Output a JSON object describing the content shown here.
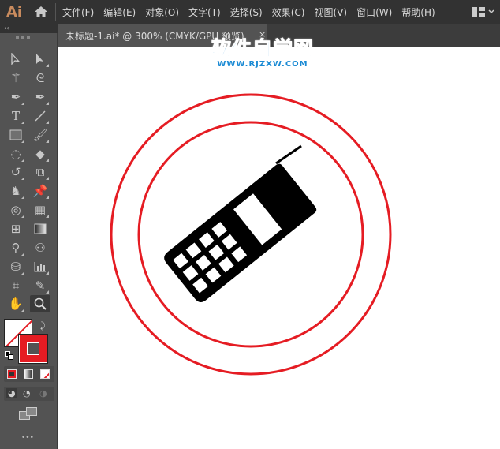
{
  "app": {
    "logo": "Ai"
  },
  "menu": [
    "文件(F)",
    "编辑(E)",
    "对象(O)",
    "文字(T)",
    "选择(S)",
    "效果(C)",
    "视图(V)",
    "窗口(W)",
    "帮助(H)"
  ],
  "tab": {
    "title": "未标题-1.ai* @ 300% (CMYK/GPU 预览)",
    "close": "×"
  },
  "panel": {
    "collapse": "‹‹",
    "more": "•••"
  },
  "watermark": {
    "name": "软件自学网",
    "url": "WWW.RJZXW.COM"
  },
  "colors": {
    "stroke": "#e51c23",
    "fill": "none",
    "phone": "#000000"
  }
}
